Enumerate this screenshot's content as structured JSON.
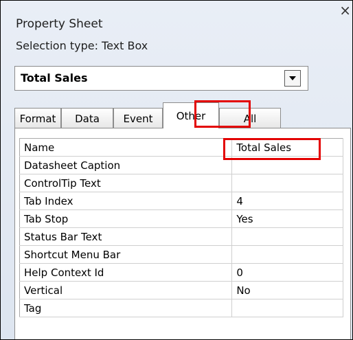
{
  "panel": {
    "title": "Property Sheet",
    "close_glyph": "×",
    "selection_type": "Selection type:  Text Box"
  },
  "selector": {
    "value": "Total Sales",
    "dropdown_icon": "chevron-down-icon"
  },
  "tabs": [
    {
      "label": "Format",
      "active": false
    },
    {
      "label": "Data",
      "active": false
    },
    {
      "label": "Event",
      "active": false
    },
    {
      "label": "Other",
      "active": true
    },
    {
      "label": "All",
      "active": false
    }
  ],
  "properties": [
    {
      "name": "Name",
      "value": "Total Sales"
    },
    {
      "name": "Datasheet Caption",
      "value": ""
    },
    {
      "name": "ControlTip Text",
      "value": ""
    },
    {
      "name": "Tab Index",
      "value": "4"
    },
    {
      "name": "Tab Stop",
      "value": "Yes"
    },
    {
      "name": "Status Bar Text",
      "value": ""
    },
    {
      "name": "Shortcut Menu Bar",
      "value": ""
    },
    {
      "name": "Help Context Id",
      "value": "0"
    },
    {
      "name": "Vertical",
      "value": "No"
    },
    {
      "name": "Tag",
      "value": ""
    }
  ],
  "colors": {
    "highlight": "#e30000",
    "panel_bg": "#dde5f0"
  }
}
